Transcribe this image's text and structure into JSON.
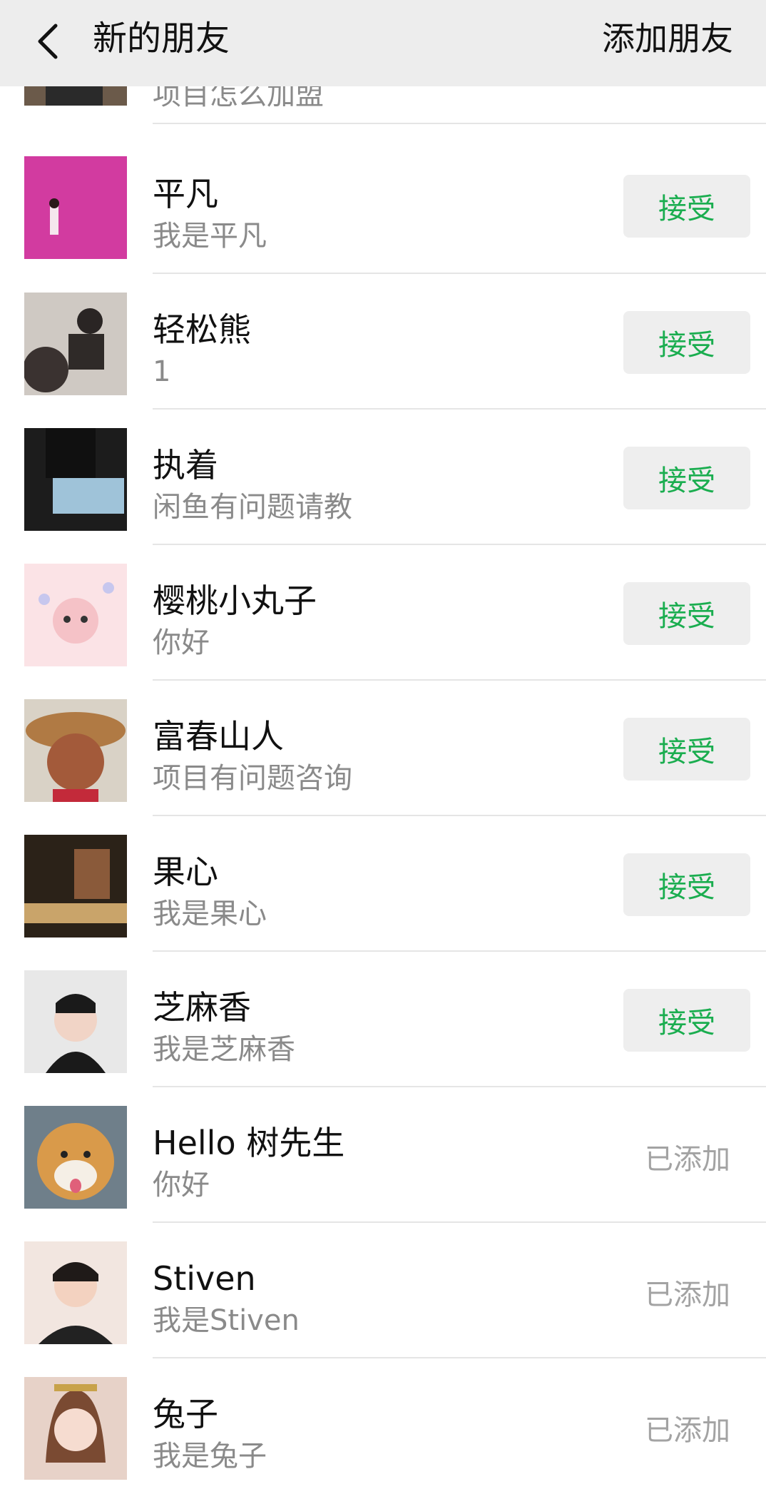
{
  "header": {
    "title": "新的朋友",
    "add_label": "添加朋友"
  },
  "requests": [
    {
      "name": "",
      "message": "项目怎么加盟",
      "status": "accept",
      "action_label": ""
    },
    {
      "name": "平凡",
      "message": "我是平凡",
      "status": "accept",
      "action_label": "接受"
    },
    {
      "name": "轻松熊",
      "message": "1",
      "status": "accept",
      "action_label": "接受"
    },
    {
      "name": "执着",
      "message": "闲鱼有问题请教",
      "status": "accept",
      "action_label": "接受"
    },
    {
      "name": "樱桃小丸子",
      "message": "你好",
      "status": "accept",
      "action_label": "接受"
    },
    {
      "name": "富春山人",
      "message": "项目有问题咨询",
      "status": "accept",
      "action_label": "接受"
    },
    {
      "name": "果心",
      "message": "我是果心",
      "status": "accept",
      "action_label": "接受"
    },
    {
      "name": "芝麻香",
      "message": "我是芝麻香",
      "status": "accept",
      "action_label": "接受"
    },
    {
      "name": "Hello 树先生",
      "message": "你好",
      "status": "added",
      "action_label": "已添加"
    },
    {
      "name": "Stiven",
      "message": "我是Stiven",
      "status": "added",
      "action_label": "已添加"
    },
    {
      "name": "兔子",
      "message": "我是兔子",
      "status": "added",
      "action_label": "已添加"
    }
  ],
  "colors": {
    "accept_text": "#1aad4f",
    "accept_bg": "#eeeeee",
    "header_bg": "#ededed"
  }
}
